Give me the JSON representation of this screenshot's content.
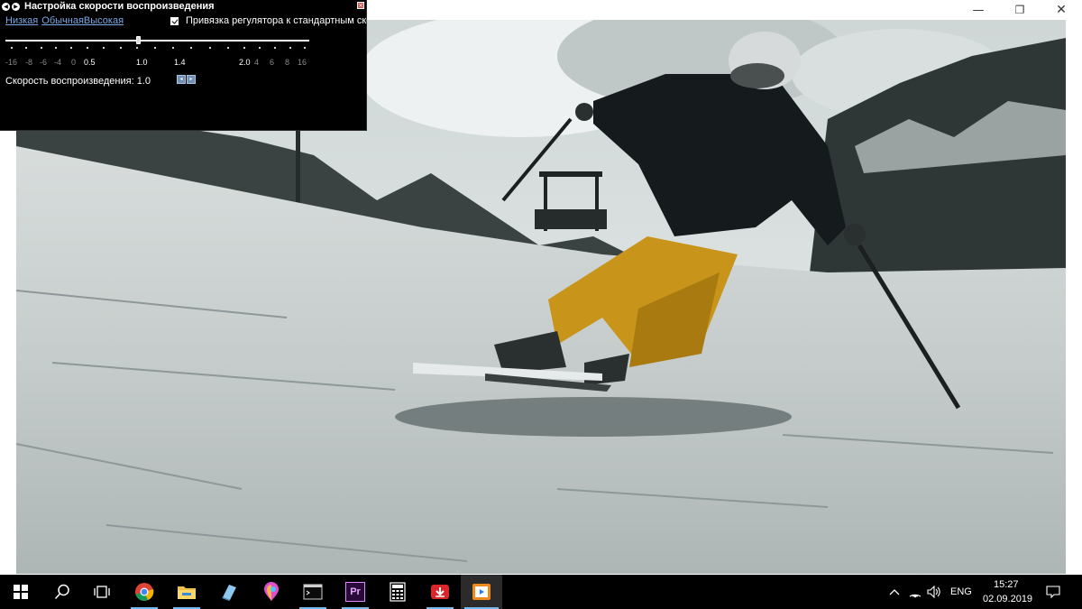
{
  "window": {
    "minimize_glyph": "—",
    "maximize_glyph": "❐",
    "close_glyph": "✕"
  },
  "speed_panel": {
    "title": "Настройка скорости воспроизведения",
    "presets": [
      "Низкая",
      "Обычная",
      "Высокая"
    ],
    "snap_checked": true,
    "snap_label": "Привязка регулятора к стандартным скорос",
    "current_speed": 1.0,
    "tick_labels": [
      "-16",
      "-8",
      "-6",
      "-4",
      "0",
      "0.5",
      "1.0",
      "1.4",
      "2.0",
      "4",
      "6",
      "8",
      "16"
    ],
    "speed_label": "Скорость воспроизведения: 1.0"
  },
  "taskbar": {
    "apps": [
      {
        "name": "start-button",
        "icon": "windows-logo-icon"
      },
      {
        "name": "search-button",
        "icon": "search-icon"
      },
      {
        "name": "task-view-button",
        "icon": "task-view-icon"
      },
      {
        "name": "chrome-button",
        "icon": "chrome-icon"
      },
      {
        "name": "file-explorer-button",
        "icon": "folder-icon"
      },
      {
        "name": "notepad-button",
        "icon": "notepad-icon"
      },
      {
        "name": "paint-3d-button",
        "icon": "paint-3d-icon"
      },
      {
        "name": "terminal-button",
        "icon": "terminal-icon"
      },
      {
        "name": "premiere-button",
        "icon": "premiere-icon",
        "label": "Pr"
      },
      {
        "name": "calculator-button",
        "icon": "calculator-icon"
      },
      {
        "name": "downloader-button",
        "icon": "download-icon"
      },
      {
        "name": "media-player-button",
        "icon": "media-player-icon",
        "active": true
      }
    ],
    "tray": {
      "language": "ENG",
      "time": "15:27",
      "date": "02.09.2019"
    }
  },
  "colors": {
    "link": "#7aa8e6",
    "taskbar_accent": "#76b9ed",
    "panel_bg": "#000000",
    "ski_pants": "#c8951a"
  }
}
